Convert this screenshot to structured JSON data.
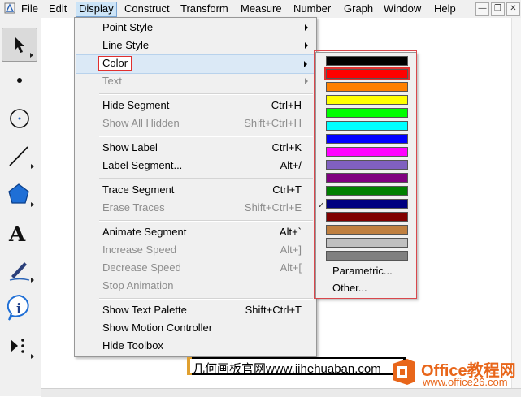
{
  "menubar": {
    "items": [
      "File",
      "Edit",
      "Display",
      "Construct",
      "Transform",
      "Measure",
      "Number",
      "Graph",
      "Window",
      "Help"
    ],
    "active": "Display",
    "window_buttons": [
      "minimize-icon",
      "restore-icon",
      "close-icon"
    ]
  },
  "toolbox": {
    "tools": [
      {
        "name": "arrow-tool",
        "icon": "arrow-icon",
        "selected": true
      },
      {
        "name": "point-tool",
        "icon": "point-icon"
      },
      {
        "name": "compass-tool",
        "icon": "circle-icon"
      },
      {
        "name": "straightedge-tool",
        "icon": "line-segment-icon"
      },
      {
        "name": "polygon-tool",
        "icon": "pentagon-icon"
      },
      {
        "name": "text-tool",
        "icon": "letter-a-icon",
        "glyph": "A"
      },
      {
        "name": "marker-tool",
        "icon": "pen-icon"
      },
      {
        "name": "information-tool",
        "icon": "info-icon",
        "glyph": "i"
      },
      {
        "name": "custom-tool",
        "icon": "play-custom-icon"
      }
    ]
  },
  "display_menu": {
    "items": [
      {
        "label": "Point Style",
        "shortcut": "",
        "submenu": true,
        "enabled": true
      },
      {
        "label": "Line Style",
        "shortcut": "",
        "submenu": true,
        "enabled": true
      },
      {
        "label": "Color",
        "shortcut": "",
        "submenu": true,
        "enabled": true,
        "highlighted": true
      },
      {
        "label": "Text",
        "shortcut": "",
        "submenu": true,
        "enabled": false
      },
      {
        "label": "Hide Segment",
        "shortcut": "Ctrl+H",
        "enabled": true
      },
      {
        "label": "Show All Hidden",
        "shortcut": "Shift+Ctrl+H",
        "enabled": false
      },
      {
        "label": "Show Label",
        "shortcut": "Ctrl+K",
        "enabled": true
      },
      {
        "label": "Label Segment...",
        "shortcut": "Alt+/",
        "enabled": true
      },
      {
        "label": "Trace Segment",
        "shortcut": "Ctrl+T",
        "enabled": true
      },
      {
        "label": "Erase Traces",
        "shortcut": "Shift+Ctrl+E",
        "enabled": false
      },
      {
        "label": "Animate Segment",
        "shortcut": "Alt+`",
        "enabled": true
      },
      {
        "label": "Increase Speed",
        "shortcut": "Alt+]",
        "enabled": false
      },
      {
        "label": "Decrease Speed",
        "shortcut": "Alt+[",
        "enabled": false
      },
      {
        "label": "Stop Animation",
        "shortcut": "",
        "enabled": false
      },
      {
        "label": "Show Text Palette",
        "shortcut": "Shift+Ctrl+T",
        "enabled": true
      },
      {
        "label": "Show Motion Controller",
        "shortcut": "",
        "enabled": true
      },
      {
        "label": "Hide Toolbox",
        "shortcut": "",
        "enabled": true
      }
    ]
  },
  "color_submenu": {
    "swatches": [
      "#000000",
      "#ff0000",
      "#ff8000",
      "#ffff00",
      "#00ff00",
      "#00ffff",
      "#0000ff",
      "#ff00ff",
      "#8060c0",
      "#800080",
      "#008000",
      "#000080",
      "#800000",
      "#c08040",
      "#c0c0c0",
      "#808080"
    ],
    "selected_index": 1,
    "checked_index": 11,
    "check_glyph": "✓",
    "parametric_label": "Parametric...",
    "other_label": "Other..."
  },
  "banner": {
    "text": "几何画板官网www.jihehuaban.com"
  },
  "watermark": {
    "brand": "Office教程网",
    "url": "www.office26.com",
    "brand_color": "#e8661a"
  }
}
